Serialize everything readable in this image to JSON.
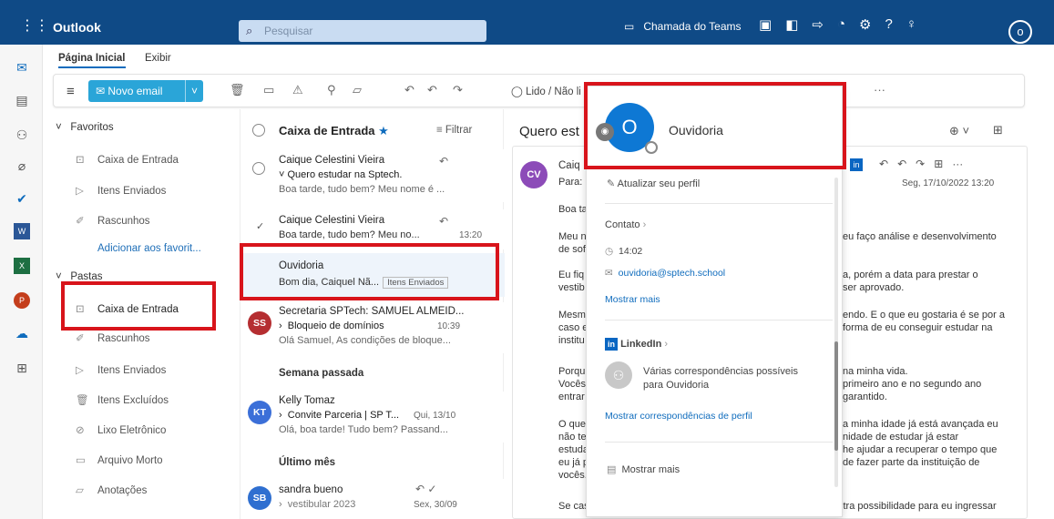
{
  "topbar": {
    "brand": "Outlook",
    "search_placeholder": "Pesquisar",
    "teams_label": "Chamada do Teams",
    "avatar_initial": "o"
  },
  "ribbon_tabs": [
    "Página Inicial",
    "Exibir"
  ],
  "ribbon": {
    "new_mail": "Novo email",
    "read_unread": "Lido / Não li"
  },
  "folders": {
    "favorites": "Favoritos",
    "fav_items": [
      "Caixa de Entrada",
      "Itens Enviados",
      "Rascunhos"
    ],
    "add_fav": "Adicionar aos favorit...",
    "folders_header": "Pastas",
    "items": [
      "Caixa de Entrada",
      "Rascunhos",
      "Itens Enviados",
      "Itens Excluídos",
      "Lixo Eletrônico",
      "Arquivo Morto",
      "Anotações"
    ]
  },
  "message_list": {
    "title": "Caixa de Entrada",
    "filter": "Filtrar",
    "messages": [
      {
        "from": "Caique Celestini Vieira",
        "subject": "Quero estudar na Sptech.",
        "preview": "Boa tarde, tudo bem? Meu nome é ...",
        "time": ""
      },
      {
        "from": "Caique Celestini Vieira",
        "subject": "",
        "preview": "Boa tarde, tudo bem? Meu no...",
        "time": "13:20"
      },
      {
        "from": "Ouvidoria",
        "subject": "",
        "preview": "Bom dia, Caiquel Nã...",
        "badge": "Itens Enviados",
        "time": ""
      },
      {
        "from": "Secretaria SPTech: SAMUEL ALMEID...",
        "subject": "Bloqueio de domínios",
        "preview": "Olá Samuel, As condições de bloque...",
        "time": "10:39",
        "initials": "SS"
      },
      {
        "from": "Kelly Tomaz",
        "subject": "Convite Parceria | SP T...",
        "preview": "Olá, boa tarde! Tudo bem? Passand...",
        "time": "Qui, 13/10",
        "initials": "KT"
      },
      {
        "from": "sandra bueno",
        "subject": "vestibular 2023",
        "preview": "",
        "time": "Sex, 30/09",
        "initials": "SB"
      }
    ],
    "section_last_week": "Semana passada",
    "section_last_month": "Último mês"
  },
  "reading": {
    "title": "Quero est",
    "from_short": "Caiq",
    "to_label": "Para:",
    "date": "Seg, 17/10/2022 13:20",
    "avatar": "CV",
    "left_lines": [
      "Boa ta",
      "Meu n",
      "de sof",
      "Eu fiq",
      "vestib",
      "Mesm",
      "caso e",
      "institu",
      "Porqu",
      "Vocês",
      "entrar",
      "O que",
      "não te",
      "estuda",
      "eu já p",
      "vocês."
    ],
    "right_lines": [
      "eu faço análise e desenvolvimento",
      "a, porém a data para prestar o",
      "ser aprovado.",
      "endo. E o que eu gostaria é se por a",
      "forma de eu conseguir estudar na",
      "na minha vida.",
      "primeiro ano e no segundo ano",
      "garantido.",
      "a minha idade já está avançada eu",
      "nidade de estudar já estar",
      "he ajudar a recuperar o tempo que",
      "de fazer parte da instituição de"
    ],
    "bottom_line": "Se caso eu não seja aprovado no vestibular de vocês. Existe outra possibilidade para eu ingressar"
  },
  "card": {
    "initial": "O",
    "name": "Ouvidoria",
    "update_profile": "Atualizar seu perfil",
    "contact": "Contato",
    "time": "14:02",
    "email": "ouvidoria@sptech.school",
    "show_more": "Mostrar mais",
    "linkedin": "LinkedIn",
    "matches": "Várias correspondências possíveis para Ouvidoria",
    "show_matches": "Mostrar correspondências de perfil",
    "show_more_bottom": "Mostrar mais"
  }
}
